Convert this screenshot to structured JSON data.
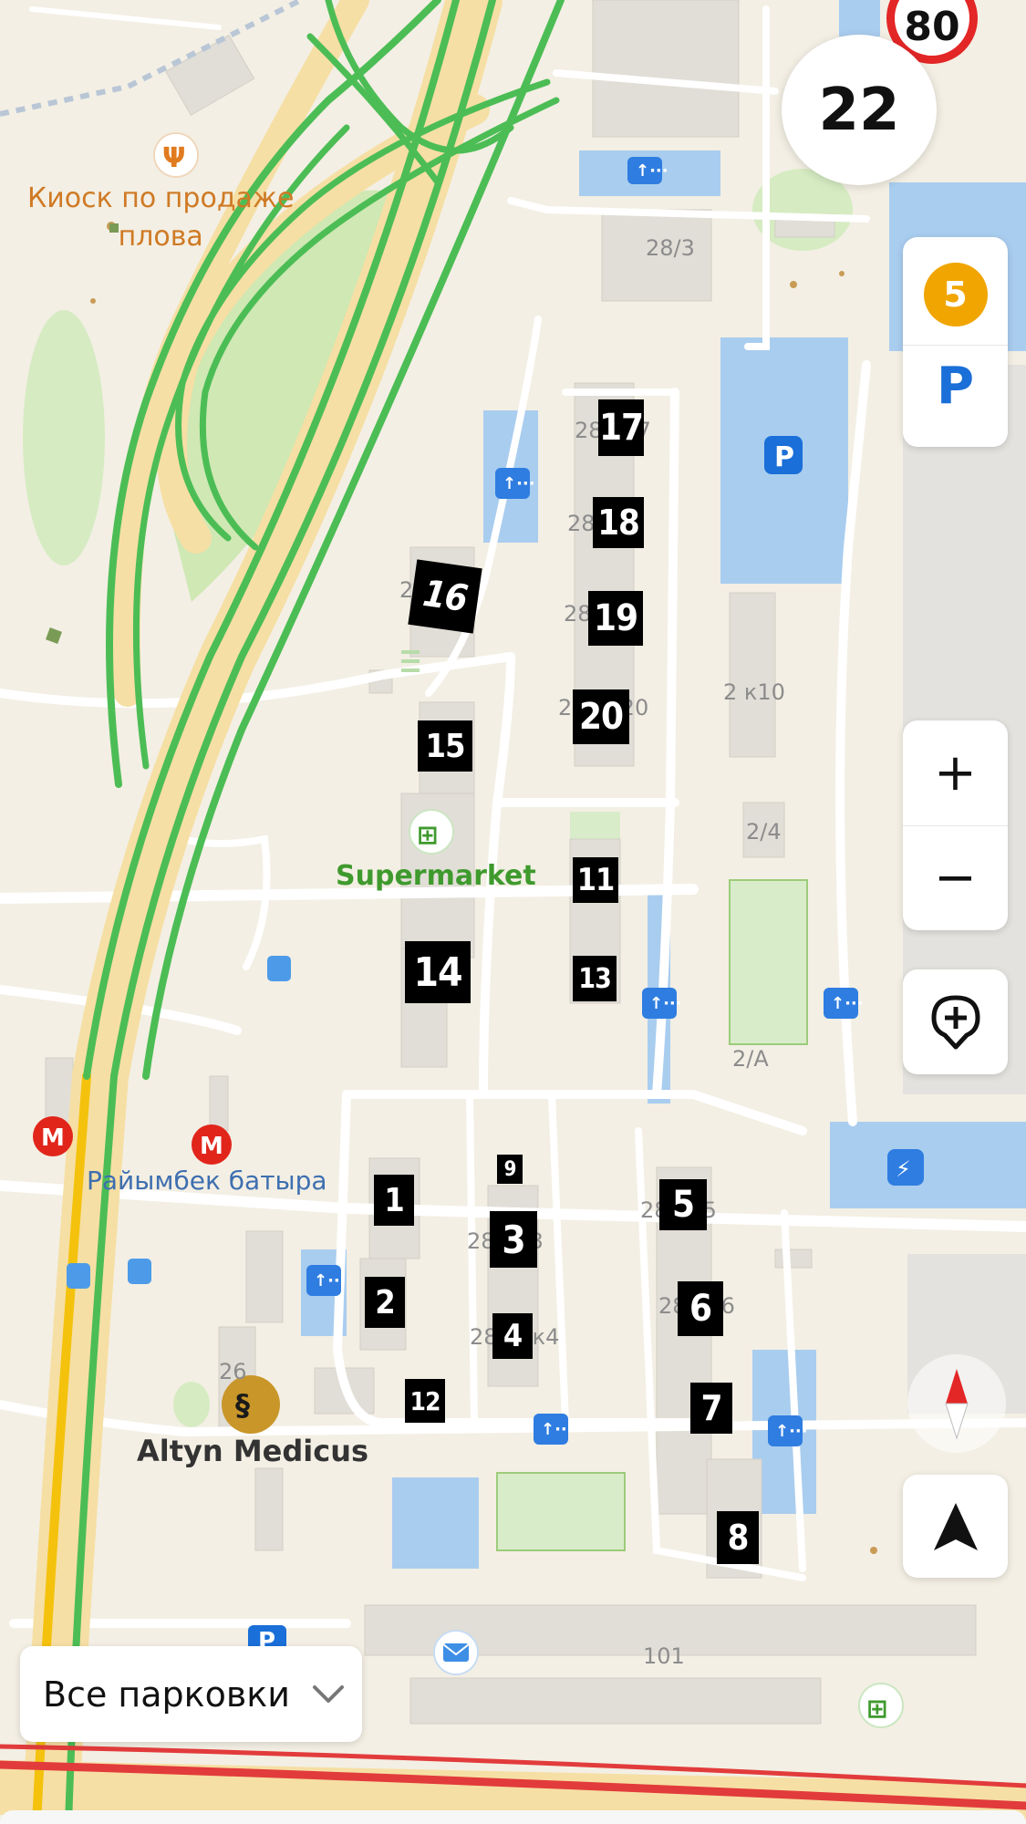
{
  "speed_limit": "80",
  "current_speed": "22",
  "map": {
    "pois": {
      "kiosk": "Киоск по продаже\nплова",
      "supermarket": "Supermarket",
      "metro": "Райымбек батыра",
      "clinic": "Altyn Medicus"
    },
    "house_numbers": {
      "h28_3": "28/3",
      "h2k10": "2 к10",
      "h2_4": "2/4",
      "h2_A": "2/А",
      "h26": "26",
      "h101": "101",
      "h28_17": "28     7",
      "h28_18": "28     8",
      "h28_16": "2       6",
      "h28_19": "28     9",
      "h28_20": "2       20",
      "h28_5": "28     5",
      "h28_3b": "28     3",
      "h28_6": "28     6",
      "h28_4": "28     к4"
    },
    "building_markers": [
      "17",
      "18",
      "16",
      "19",
      "20",
      "15",
      "11",
      "14",
      "13",
      "9",
      "1",
      "3",
      "5",
      "2",
      "4",
      "6",
      "12",
      "7",
      "8"
    ]
  },
  "controls": {
    "parking_count": "5",
    "parking_label": "P",
    "zoom_in": "+",
    "zoom_out": "−",
    "filter_button": "Все парковки"
  },
  "colors": {
    "traffic_green": "#4cbd55",
    "traffic_yellow": "#f4c20d",
    "traffic_red": "#e23b3b",
    "parking_blue": "#1a6fd8",
    "metro_red": "#e1251b",
    "speed_sign_red": "#e32626"
  },
  "icons": {
    "speed_limit": "speed-limit-sign-icon",
    "parking": "parking-icon",
    "add_place": "add-place-icon",
    "compass": "compass-icon",
    "navigate": "navigation-arrow-icon",
    "metro": "metro-icon",
    "bus": "bus-stop-icon",
    "entrance": "entrance-icon",
    "mail": "mail-icon",
    "shop": "shop-icon",
    "restaurant": "restaurant-icon",
    "ev_charger": "ev-charger-icon"
  }
}
